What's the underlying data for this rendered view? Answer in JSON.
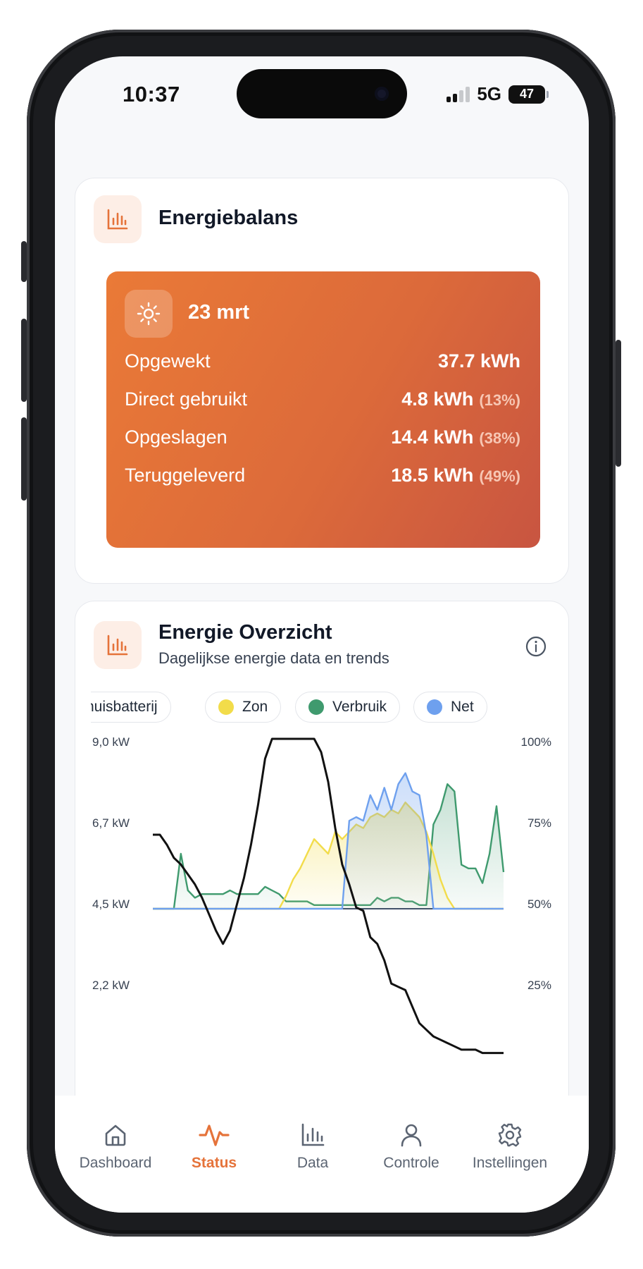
{
  "status_bar": {
    "time": "10:37",
    "network": "5G",
    "battery": "47"
  },
  "energiebalans": {
    "title": "Energiebalans",
    "icon": "bar-chart-icon",
    "date": "23 mrt",
    "rows": [
      {
        "label": "Opgewekt",
        "value": "37.7 kWh",
        "percent": ""
      },
      {
        "label": "Direct gebruikt",
        "value": "4.8 kWh",
        "percent": "(13%)"
      },
      {
        "label": "Opgeslagen",
        "value": "14.4 kWh",
        "percent": "(38%)"
      },
      {
        "label": "Teruggeleverd",
        "value": "18.5 kWh",
        "percent": "(49%)"
      }
    ],
    "colors": {
      "gradient_start": "#ea7a37",
      "gradient_end": "#c85541"
    }
  },
  "overzicht": {
    "title": "Energie Overzicht",
    "subtitle": "Dagelijkse energie data en trends",
    "legend": [
      {
        "label": "huisbatterij",
        "color": ""
      },
      {
        "label": "Zon",
        "color": "#f2dc4a"
      },
      {
        "label": "Verbruik",
        "color": "#3f9a6e"
      },
      {
        "label": "Net",
        "color": "#6ea0ee"
      }
    ]
  },
  "chart_data": {
    "type": "area",
    "left_axis": {
      "ticks": [
        "9,0 kW",
        "6,7 kW",
        "4,5 kW",
        "2,2 kW"
      ],
      "range": [
        0,
        9.0
      ]
    },
    "right_axis": {
      "ticks": [
        "100%",
        "75%",
        "50%",
        "25%"
      ],
      "range": [
        0,
        100
      ]
    },
    "x": [
      0,
      1,
      2,
      3,
      4,
      5,
      6,
      7,
      8,
      9,
      10,
      11,
      12,
      13,
      14,
      15,
      16,
      17,
      18,
      19,
      20,
      21,
      22,
      23,
      24,
      25,
      26,
      27,
      28,
      29,
      30,
      31,
      32,
      33,
      34,
      35,
      36,
      37,
      38,
      39,
      40,
      41,
      42,
      43,
      44,
      45,
      46,
      47,
      48,
      49,
      50
    ],
    "series": [
      {
        "name": "Zon",
        "color": "#f2dc4a",
        "values": [
          0,
          0,
          0,
          0,
          0,
          0,
          0,
          0,
          0,
          0,
          0,
          0,
          0,
          0,
          0,
          0,
          0,
          0,
          0,
          0.35,
          0.8,
          1.1,
          1.5,
          1.9,
          1.7,
          1.5,
          2.1,
          1.9,
          2.1,
          2.3,
          2.2,
          2.5,
          2.6,
          2.5,
          2.7,
          2.6,
          2.9,
          2.7,
          2.5,
          2.1,
          1.5,
          0.8,
          0.3,
          0,
          0,
          0,
          0,
          0,
          0,
          0,
          0
        ]
      },
      {
        "name": "Verbruik",
        "color": "#3f9a6e",
        "values": [
          0,
          0,
          0,
          0,
          1.5,
          0.5,
          0.3,
          0.4,
          0.4,
          0.4,
          0.4,
          0.5,
          0.4,
          0.4,
          0.4,
          0.4,
          0.6,
          0.5,
          0.4,
          0.2,
          0.2,
          0.2,
          0.2,
          0.1,
          0.1,
          0.1,
          0.1,
          0.1,
          0.1,
          0.1,
          0.1,
          0.1,
          0.3,
          0.2,
          0.3,
          0.3,
          0.2,
          0.2,
          0.1,
          0.1,
          2.3,
          2.7,
          3.4,
          3.2,
          1.2,
          1.1,
          1.1,
          0.7,
          1.5,
          2.8,
          1.0
        ]
      },
      {
        "name": "Net",
        "color": "#6ea0ee",
        "values": [
          0,
          0,
          0,
          0,
          0,
          0,
          0,
          0,
          0,
          0,
          0,
          0,
          0,
          0,
          0,
          0,
          0,
          0,
          0,
          0,
          0,
          0,
          0,
          0,
          0,
          0,
          0,
          0,
          2.4,
          2.5,
          2.4,
          3.1,
          2.7,
          3.3,
          2.7,
          3.4,
          3.7,
          3.2,
          3.1,
          2.0,
          0,
          0,
          0,
          0,
          0,
          0,
          0,
          0,
          0,
          0,
          0
        ]
      },
      {
        "name": "huisbatterij",
        "color": "#111111",
        "unit": "%",
        "values": [
          71,
          71,
          68,
          64,
          62,
          59,
          56,
          52,
          47,
          42,
          38,
          42,
          50,
          58,
          68,
          80,
          94,
          100,
          100,
          100,
          100,
          100,
          100,
          100,
          96,
          87,
          73,
          62,
          56,
          49,
          48,
          40,
          38,
          33,
          26,
          25,
          24,
          19,
          14,
          12,
          10,
          9,
          8,
          7,
          6,
          6,
          6,
          5,
          5,
          5,
          5
        ]
      }
    ]
  },
  "tabbar": {
    "items": [
      {
        "label": "Dashboard",
        "icon": "home-icon"
      },
      {
        "label": "Status",
        "icon": "pulse-icon",
        "active": true
      },
      {
        "label": "Data",
        "icon": "bar-chart-icon"
      },
      {
        "label": "Controle",
        "icon": "user-icon"
      },
      {
        "label": "Instellingen",
        "icon": "gear-icon"
      }
    ],
    "active_color": "#e5733a"
  }
}
